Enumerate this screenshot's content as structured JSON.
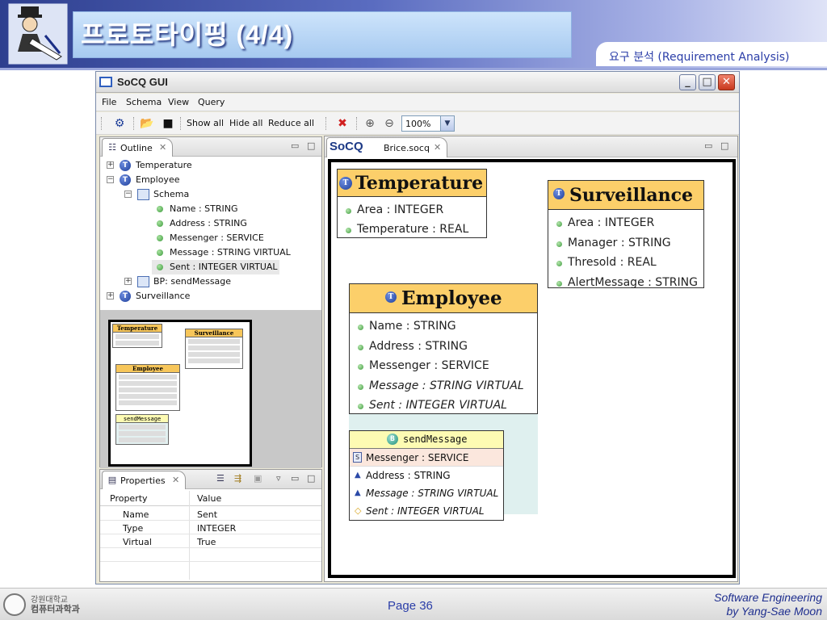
{
  "slide": {
    "title": "프로토타이핑 (4/4)",
    "subtitle": "요구 분석 (Requirement Analysis)",
    "page": "Page 36",
    "course": "Software Engineering",
    "author": "by Yang-Sae Moon",
    "org_line1": "강원대학교",
    "org_line2": "컴퓨터과학과"
  },
  "window": {
    "title": "SoCQ GUI",
    "controls": {
      "minimize": "_",
      "maximize": "□",
      "close": "✕"
    }
  },
  "menu": [
    "File",
    "Schema",
    "View",
    "Query"
  ],
  "toolbar": {
    "show_all": "Show all",
    "hide_all": "Hide all",
    "reduce_all": "Reduce all",
    "zoom": "100%"
  },
  "outline": {
    "tab_label": "Outline",
    "tree": [
      {
        "label": "Temperature"
      },
      {
        "label": "Employee"
      },
      {
        "label": "Schema"
      },
      {
        "label": "Name : STRING"
      },
      {
        "label": "Address : STRING"
      },
      {
        "label": "Messenger : SERVICE"
      },
      {
        "label": "Message : STRING VIRTUAL"
      },
      {
        "label": "Sent : INTEGER VIRTUAL"
      },
      {
        "label": "BP: sendMessage"
      },
      {
        "label": "Surveillance"
      }
    ],
    "overview": {
      "temperature": "Temperature",
      "surveillance": "Surveillance",
      "employee": "Employee",
      "send_message": "sendMessage"
    }
  },
  "properties": {
    "tab_label": "Properties",
    "headers": [
      "Property",
      "Value"
    ],
    "rows": [
      {
        "property": "Name",
        "value": "Sent"
      },
      {
        "property": "Type",
        "value": "INTEGER"
      },
      {
        "property": "Virtual",
        "value": "True"
      }
    ]
  },
  "editor": {
    "tab_logo": "SoCQ",
    "tab_label": "Brice.socq",
    "classes": {
      "temperature": {
        "name": "Temperature",
        "attrs": [
          "Area : INTEGER",
          "Temperature : REAL"
        ]
      },
      "surveillance": {
        "name": "Surveillance",
        "attrs": [
          "Area : INTEGER",
          "Manager : STRING",
          "Thresold : REAL",
          "AlertMessage : STRING"
        ]
      },
      "employee": {
        "name": "Employee",
        "attrs": [
          "Name : STRING",
          "Address : STRING",
          "Messenger : SERVICE"
        ],
        "virtual_attrs": [
          "Message : STRING VIRTUAL",
          "Sent : INTEGER VIRTUAL"
        ]
      }
    },
    "binding_pattern": {
      "name": "sendMessage",
      "rows": [
        "Messenger : SERVICE",
        "Address : STRING",
        "Message : STRING VIRTUAL",
        "Sent : INTEGER VIRTUAL"
      ]
    }
  },
  "colors": {
    "class_header": "#fccf6a",
    "bp_header": "#fdfbb3",
    "accent_blue": "#2b3ea8"
  }
}
